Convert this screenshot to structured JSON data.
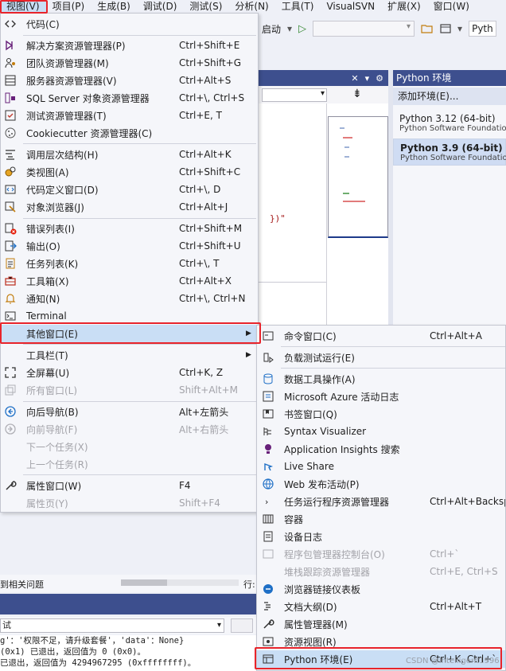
{
  "menubar": {
    "items": [
      "视图(V)",
      "项目(P)",
      "生成(B)",
      "调试(D)",
      "测试(S)",
      "分析(N)",
      "工具(T)",
      "VisualSVN",
      "扩展(X)",
      "窗口(W)"
    ]
  },
  "toolbar": {
    "start_label": "启动",
    "python_box": "Pyth"
  },
  "editor": {
    "code_fragment": "})\""
  },
  "python_envs": {
    "title": "Python 环境",
    "add_label": "添加环境(E)...",
    "envs": [
      {
        "name": "Python 3.12 (64-bit)",
        "vendor": "Python Software Foundation"
      },
      {
        "name": "Python 3.9 (64-bit)",
        "vendor": "Python Software Foundation"
      }
    ]
  },
  "view_menu": {
    "items": [
      {
        "label": "代码(C)",
        "shortcut": "",
        "icon": "code-icon"
      },
      {
        "label": "解决方案资源管理器(P)",
        "shortcut": "Ctrl+Shift+E",
        "icon": "solution-explorer-icon"
      },
      {
        "label": "团队资源管理器(M)",
        "shortcut": "Ctrl+Shift+G",
        "icon": "team-explorer-icon"
      },
      {
        "label": "服务器资源管理器(V)",
        "shortcut": "Ctrl+Alt+S",
        "icon": "server-explorer-icon"
      },
      {
        "label": "SQL Server 对象资源管理器",
        "shortcut": "Ctrl+\\, Ctrl+S",
        "icon": "sql-server-icon"
      },
      {
        "label": "测试资源管理器(T)",
        "shortcut": "Ctrl+E, T",
        "icon": "test-explorer-icon"
      },
      {
        "label": "Cookiecutter 资源管理器(C)",
        "shortcut": "",
        "icon": "cookiecutter-icon"
      },
      {
        "label": "调用层次结构(H)",
        "shortcut": "Ctrl+Alt+K",
        "icon": "call-hierarchy-icon"
      },
      {
        "label": "类视图(A)",
        "shortcut": "Ctrl+Shift+C",
        "icon": "class-view-icon"
      },
      {
        "label": "代码定义窗口(D)",
        "shortcut": "Ctrl+\\, D",
        "icon": "code-definition-icon"
      },
      {
        "label": "对象浏览器(J)",
        "shortcut": "Ctrl+Alt+J",
        "icon": "object-browser-icon"
      },
      {
        "label": "错误列表(I)",
        "shortcut": "Ctrl+Shift+M",
        "icon": "error-list-icon"
      },
      {
        "label": "输出(O)",
        "shortcut": "Ctrl+Shift+U",
        "icon": "output-icon"
      },
      {
        "label": "任务列表(K)",
        "shortcut": "Ctrl+\\, T",
        "icon": "task-list-icon"
      },
      {
        "label": "工具箱(X)",
        "shortcut": "Ctrl+Alt+X",
        "icon": "toolbox-icon"
      },
      {
        "label": "通知(N)",
        "shortcut": "Ctrl+\\, Ctrl+N",
        "icon": "bell-icon"
      },
      {
        "label": "Terminal",
        "shortcut": "",
        "icon": "terminal-icon"
      },
      {
        "label": "其他窗口(E)",
        "shortcut": "",
        "icon": ""
      },
      {
        "label": "工具栏(T)",
        "shortcut": "",
        "icon": ""
      },
      {
        "label": "全屏幕(U)",
        "shortcut": "Ctrl+K, Z",
        "icon": "fullscreen-icon"
      },
      {
        "label": "所有窗口(L)",
        "shortcut": "Shift+Alt+M",
        "icon": "all-windows-icon"
      },
      {
        "label": "向后导航(B)",
        "shortcut": "Alt+左箭头",
        "icon": "navigate-back-icon"
      },
      {
        "label": "向前导航(F)",
        "shortcut": "Alt+右箭头",
        "icon": "navigate-forward-icon"
      },
      {
        "label": "下一个任务(X)",
        "shortcut": "",
        "icon": ""
      },
      {
        "label": "上一个任务(R)",
        "shortcut": "",
        "icon": ""
      },
      {
        "label": "属性窗口(W)",
        "shortcut": "F4",
        "icon": "wrench-icon"
      },
      {
        "label": "属性页(Y)",
        "shortcut": "Shift+F4",
        "icon": ""
      }
    ]
  },
  "other_windows_submenu": {
    "items": [
      {
        "label": "命令窗口(C)",
        "shortcut": "Ctrl+Alt+A",
        "icon": "command-window-icon"
      },
      {
        "label": "负载测试运行(E)",
        "shortcut": "",
        "icon": "load-test-icon"
      },
      {
        "label": "数据工具操作(A)",
        "shortcut": "",
        "icon": "data-tools-icon"
      },
      {
        "label": "Microsoft Azure 活动日志",
        "shortcut": "",
        "icon": "azure-log-icon"
      },
      {
        "label": "书签窗口(Q)",
        "shortcut": "",
        "icon": "bookmark-icon"
      },
      {
        "label": "Syntax Visualizer",
        "shortcut": "",
        "icon": "syntax-visualizer-icon"
      },
      {
        "label": "Application Insights 搜索",
        "shortcut": "",
        "icon": "app-insights-icon"
      },
      {
        "label": "Live Share",
        "shortcut": "",
        "icon": "live-share-icon"
      },
      {
        "label": "Web 发布活动(P)",
        "shortcut": "",
        "icon": "web-publish-icon"
      },
      {
        "label": "任务运行程序资源管理器",
        "shortcut": "Ctrl+Alt+Backsp",
        "icon": ""
      },
      {
        "label": "容器",
        "shortcut": "",
        "icon": "container-icon"
      },
      {
        "label": "设备日志",
        "shortcut": "",
        "icon": "device-log-icon"
      },
      {
        "label": "程序包管理器控制台(O)",
        "shortcut": "Ctrl+`",
        "icon": "package-console-icon"
      },
      {
        "label": "堆栈跟踪资源管理器",
        "shortcut": "Ctrl+E, Ctrl+S",
        "icon": ""
      },
      {
        "label": "浏览器链接仪表板",
        "shortcut": "",
        "icon": "browser-link-icon"
      },
      {
        "label": "文档大纲(D)",
        "shortcut": "Ctrl+Alt+T",
        "icon": "document-outline-icon"
      },
      {
        "label": "属性管理器(M)",
        "shortcut": "",
        "icon": "property-manager-icon"
      },
      {
        "label": "资源视图(R)",
        "shortcut": "",
        "icon": "resource-view-icon"
      },
      {
        "label": "Python 环境(E)",
        "shortcut": "Ctrl+K, Ctrl+`",
        "icon": "python-env-icon"
      }
    ]
  },
  "status": {
    "left_text": "到相关问题",
    "right_text": "行:"
  },
  "output": {
    "source": "试",
    "lines": [
      "g'：'权限不足，请升级套餐'，'data'：None}",
      "(0x1) 已退出，返回值为 0 (0x0)。",
      "已退出，返回值为 4294967295 (0xffffffff)。"
    ]
  },
  "watermark": "CSDN @Intelligent1996",
  "colors": {
    "accent_header": "#3d4f8e",
    "highlight": "#c9def5",
    "annotation_red": "#e8242b"
  }
}
